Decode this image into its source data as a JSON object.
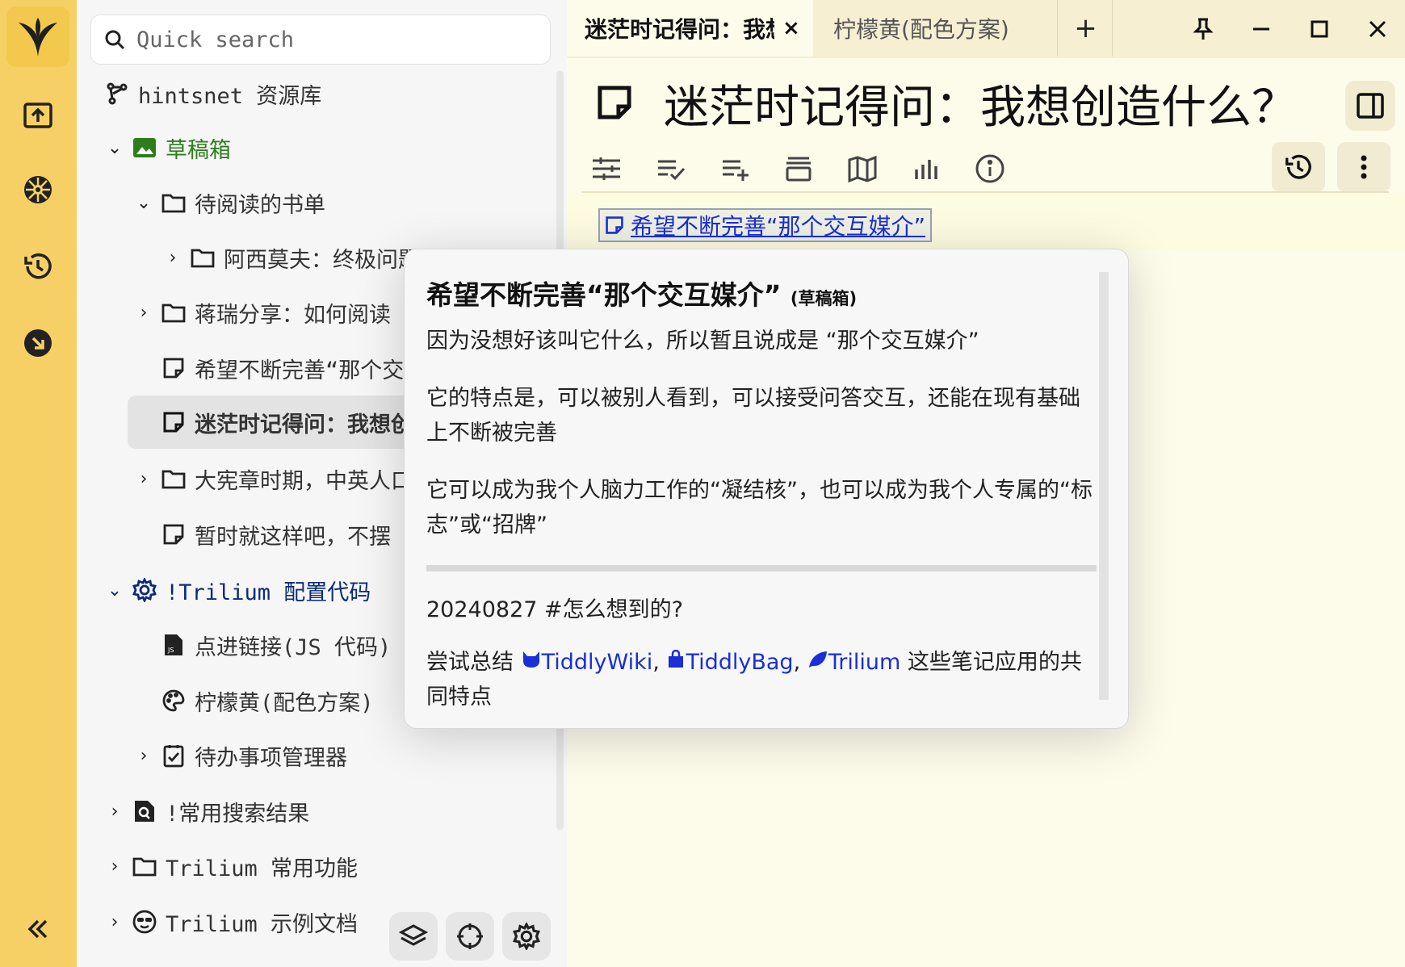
{
  "colors": {
    "accent": "#f6d065",
    "tree_bg": "#f6f6f6",
    "link": "#1a2fd6",
    "green": "#2e7d1d",
    "navy": "#0b2a7a"
  },
  "launcher": {
    "items": [
      {
        "icon": "trilium-logo-icon"
      },
      {
        "icon": "open-today-icon"
      },
      {
        "icon": "helm-icon"
      },
      {
        "icon": "history-icon"
      },
      {
        "icon": "download-arrow-icon"
      },
      {
        "icon": "collapse-icon"
      }
    ]
  },
  "search": {
    "placeholder": "Quick search"
  },
  "tree": {
    "root": "hintsnet 资源库",
    "items": [
      {
        "label": "草稿箱"
      },
      {
        "label": "待阅读的书单"
      },
      {
        "label": "阿西莫夫：终极问题"
      },
      {
        "label": "蒋瑞分享：如何阅读"
      },
      {
        "label": "希望不断完善“那个交互媒介”"
      },
      {
        "label": "迷茫时记得问：我想创造什么？"
      },
      {
        "label": "大宪章时期，中英人口"
      },
      {
        "label": "暂时就这样吧，不摆"
      },
      {
        "label": "!Trilium 配置代码"
      },
      {
        "label": "点进链接(JS 代码)"
      },
      {
        "label": "柠檬黄(配色方案)"
      },
      {
        "label": "待办事项管理器"
      },
      {
        "label": "!常用搜索结果"
      },
      {
        "label": "Trilium 常用功能"
      },
      {
        "label": "Trilium 示例文档"
      }
    ]
  },
  "tabs": [
    {
      "title": "迷茫时记得问：我想创造什么？",
      "close": "×"
    },
    {
      "title": "柠檬黄(配色方案)"
    }
  ],
  "tab_add": "+",
  "note": {
    "title": "迷茫时记得问：我想创造什么？",
    "link": "希望不断完善“那个交互媒介”"
  },
  "popup": {
    "title": "希望不断完善“那个交互媒介”",
    "parent": "(草稿箱)",
    "p1": "因为没想好该叫它什么，所以暂且说成是 “那个交互媒介”",
    "p2": "它的特点是，可以被别人看到，可以接受问答交互，还能在现有基础上不断被完善",
    "p3": "它可以成为我个人脑力工作的“凝结核”，也可以成为我个人专属的“标志”或“招牌”",
    "p4": "20240827 #怎么想到的?",
    "p5_prefix": "尝试总结",
    "app1": "TiddlyWiki",
    "app2": "TiddlyBag",
    "app3": "Trilium",
    "p5_suffix": "这些笔记应用的共同特点"
  }
}
